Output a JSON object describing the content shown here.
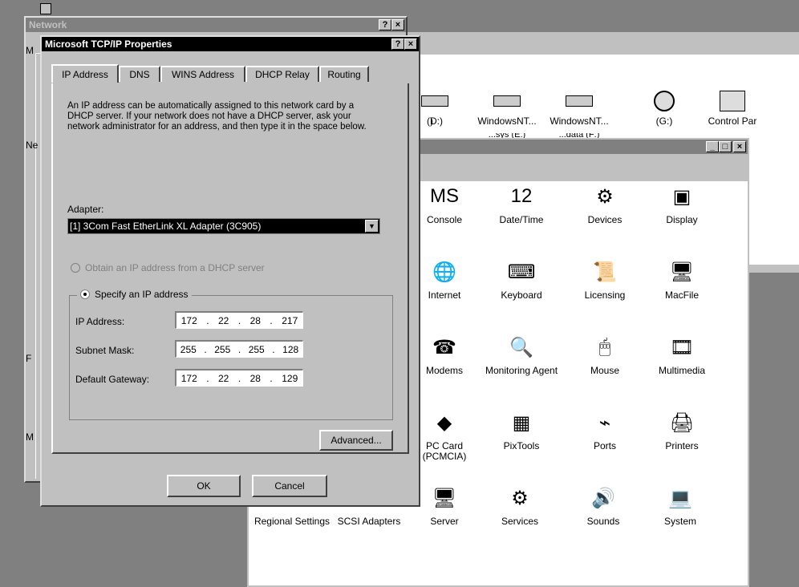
{
  "network_window": {
    "title": "Network",
    "help_btn": "?",
    "close_btn": "×",
    "clipped_left_labels": [
      "M",
      "Ne",
      "F",
      "M"
    ]
  },
  "explorer_window": {
    "drives": [
      {
        "label": ")",
        "icon": "drive-icon"
      },
      {
        "label": "(D:)",
        "icon": "drive-icon"
      },
      {
        "label": "WindowsNT...",
        "icon": "drive-icon"
      },
      {
        "label": "WindowsNT...",
        "icon": "drive-icon"
      },
      {
        "label": "(G:)",
        "icon": "cdrom-icon"
      },
      {
        "label": "Control Par",
        "icon": "control-panel-folder-icon"
      }
    ],
    "drive_sublabels": [
      "...sys (E:)",
      "...data (F:)"
    ]
  },
  "control_panel": {
    "min_btn": "_",
    "max_btn": "□",
    "close_btn": "×",
    "items": [
      {
        "label": "Console",
        "icon": "console-icon",
        "glyph": "MS"
      },
      {
        "label": "Date/Time",
        "icon": "datetime-icon",
        "glyph": "12"
      },
      {
        "label": "Devices",
        "icon": "devices-icon",
        "glyph": "⚙"
      },
      {
        "label": "Display",
        "icon": "display-icon",
        "glyph": "▣"
      },
      {
        "label": "Internet",
        "icon": "internet-icon",
        "glyph": "🌐"
      },
      {
        "label": "Keyboard",
        "icon": "keyboard-icon",
        "glyph": "⌨"
      },
      {
        "label": "Licensing",
        "icon": "licensing-icon",
        "glyph": "📜"
      },
      {
        "label": "MacFile",
        "icon": "macfile-icon",
        "glyph": "🖥"
      },
      {
        "label": "Modems",
        "icon": "modems-icon",
        "glyph": "☎"
      },
      {
        "label": "Monitoring Agent",
        "icon": "monitoring-agent-icon",
        "glyph": "🔍"
      },
      {
        "label": "Mouse",
        "icon": "mouse-icon",
        "glyph": "🖱"
      },
      {
        "label": "Multimedia",
        "icon": "multimedia-icon",
        "glyph": "🎞"
      },
      {
        "label": "PC Card (PCMCIA)",
        "icon": "pc-card-icon",
        "glyph": "◆"
      },
      {
        "label": "PixTools",
        "icon": "pixtools-icon",
        "glyph": "▦"
      },
      {
        "label": "Ports",
        "icon": "ports-icon",
        "glyph": "⌁"
      },
      {
        "label": "Printers",
        "icon": "printers-icon",
        "glyph": "🖨"
      },
      {
        "label": "Regional Settings",
        "icon": "regional-settings-icon",
        "glyph": "●"
      },
      {
        "label": "SCSI Adapters",
        "icon": "scsi-adapters-icon",
        "glyph": "⇐"
      },
      {
        "label": "Server",
        "icon": "server-icon",
        "glyph": "🖥"
      },
      {
        "label": "Services",
        "icon": "services-icon",
        "glyph": "⚙"
      },
      {
        "label": "Sounds",
        "icon": "sounds-icon",
        "glyph": "🔊"
      },
      {
        "label": "System",
        "icon": "system-icon",
        "glyph": "💻"
      }
    ]
  },
  "tcpip_dialog": {
    "title": "Microsoft TCP/IP Properties",
    "help_btn": "?",
    "close_btn": "×",
    "tabs": [
      "IP Address",
      "DNS",
      "WINS Address",
      "DHCP Relay",
      "Routing"
    ],
    "description": "An IP address can be automatically assigned to this network card by a DHCP server.  If your network does not have a DHCP server, ask your network administrator for an address, and then type it in the space below.",
    "adapter_label": "Adapter:",
    "adapter_value": "[1] 3Com Fast EtherLink XL Adapter (3C905)",
    "radio_dhcp": "Obtain an IP address from a DHCP server",
    "radio_specify": "Specify an IP address",
    "ip_label": "IP Address:",
    "ip_value": [
      "172",
      "22",
      "28",
      "217"
    ],
    "subnet_label": "Subnet Mask:",
    "subnet_value": [
      "255",
      "255",
      "255",
      "128"
    ],
    "gateway_label": "Default Gateway:",
    "gateway_value": [
      "172",
      "22",
      "28",
      "129"
    ],
    "advanced_btn": "Advanced...",
    "ok_btn": "OK",
    "cancel_btn": "Cancel"
  }
}
